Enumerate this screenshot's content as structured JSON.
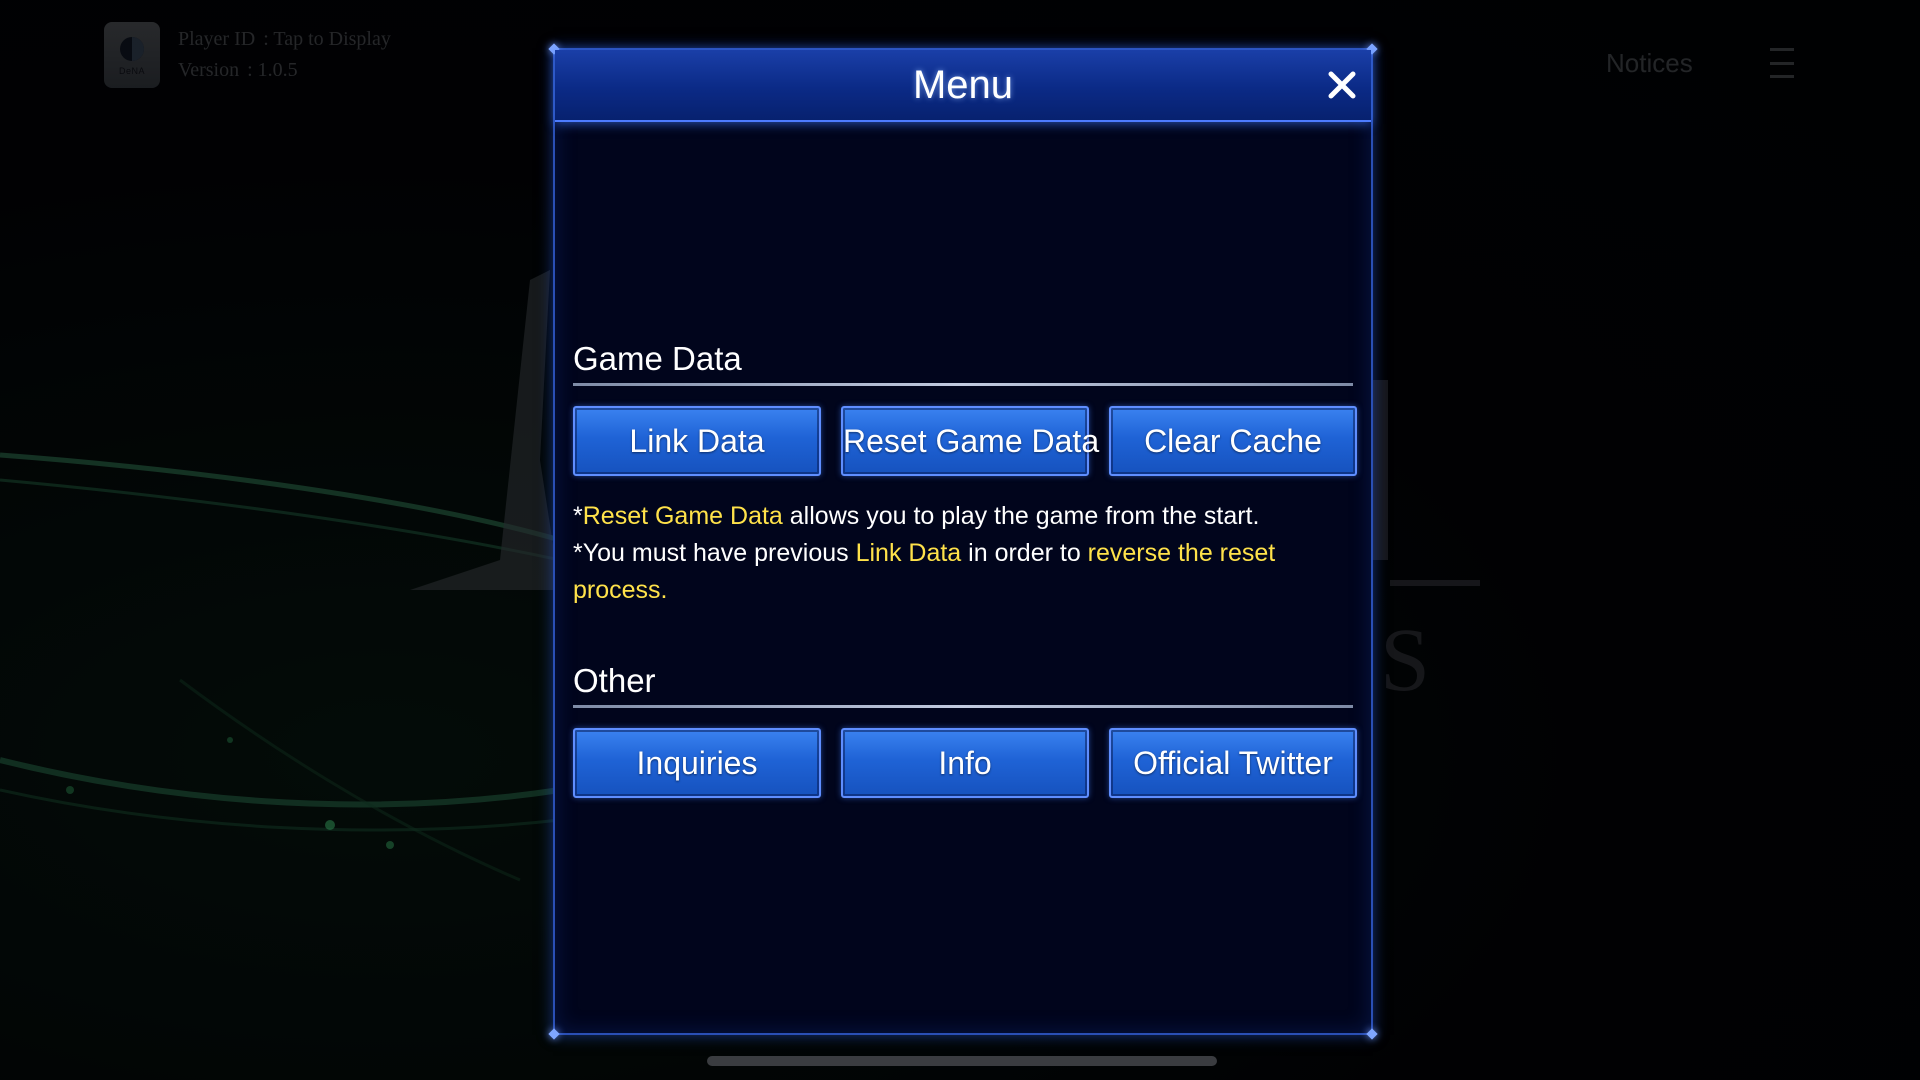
{
  "player": {
    "id_label": "Player ID",
    "id_value": ": Tap to Display",
    "version_label": "Version",
    "version_value": ": 1.0.5",
    "icon_brand": "DeNA"
  },
  "header": {
    "notices_label": "Notices",
    "menu_icon": "hamburger-icon"
  },
  "modal": {
    "title": "Menu",
    "close_icon": "close-icon",
    "sections": {
      "game_data": {
        "title": "Game Data",
        "buttons": [
          "Link Data",
          "Reset Game Data",
          "Clear Cache"
        ]
      },
      "other": {
        "title": "Other",
        "buttons": [
          "Inquiries",
          "Info",
          "Official Twitter"
        ]
      }
    },
    "notes": {
      "line1_prefix": "*",
      "line1_highlight": "Reset Game Data",
      "line1_rest": " allows you to play the game from the start.",
      "line2_prefix": "*You must have previous ",
      "line2_highlight": "Link Data",
      "line2_mid": " in order to ",
      "line2_highlight2": "reverse the reset process."
    }
  },
  "colors": {
    "accent_blue": "#1f63d6",
    "highlight_yellow": "#ffe24a",
    "modal_bg": "#01051c"
  }
}
